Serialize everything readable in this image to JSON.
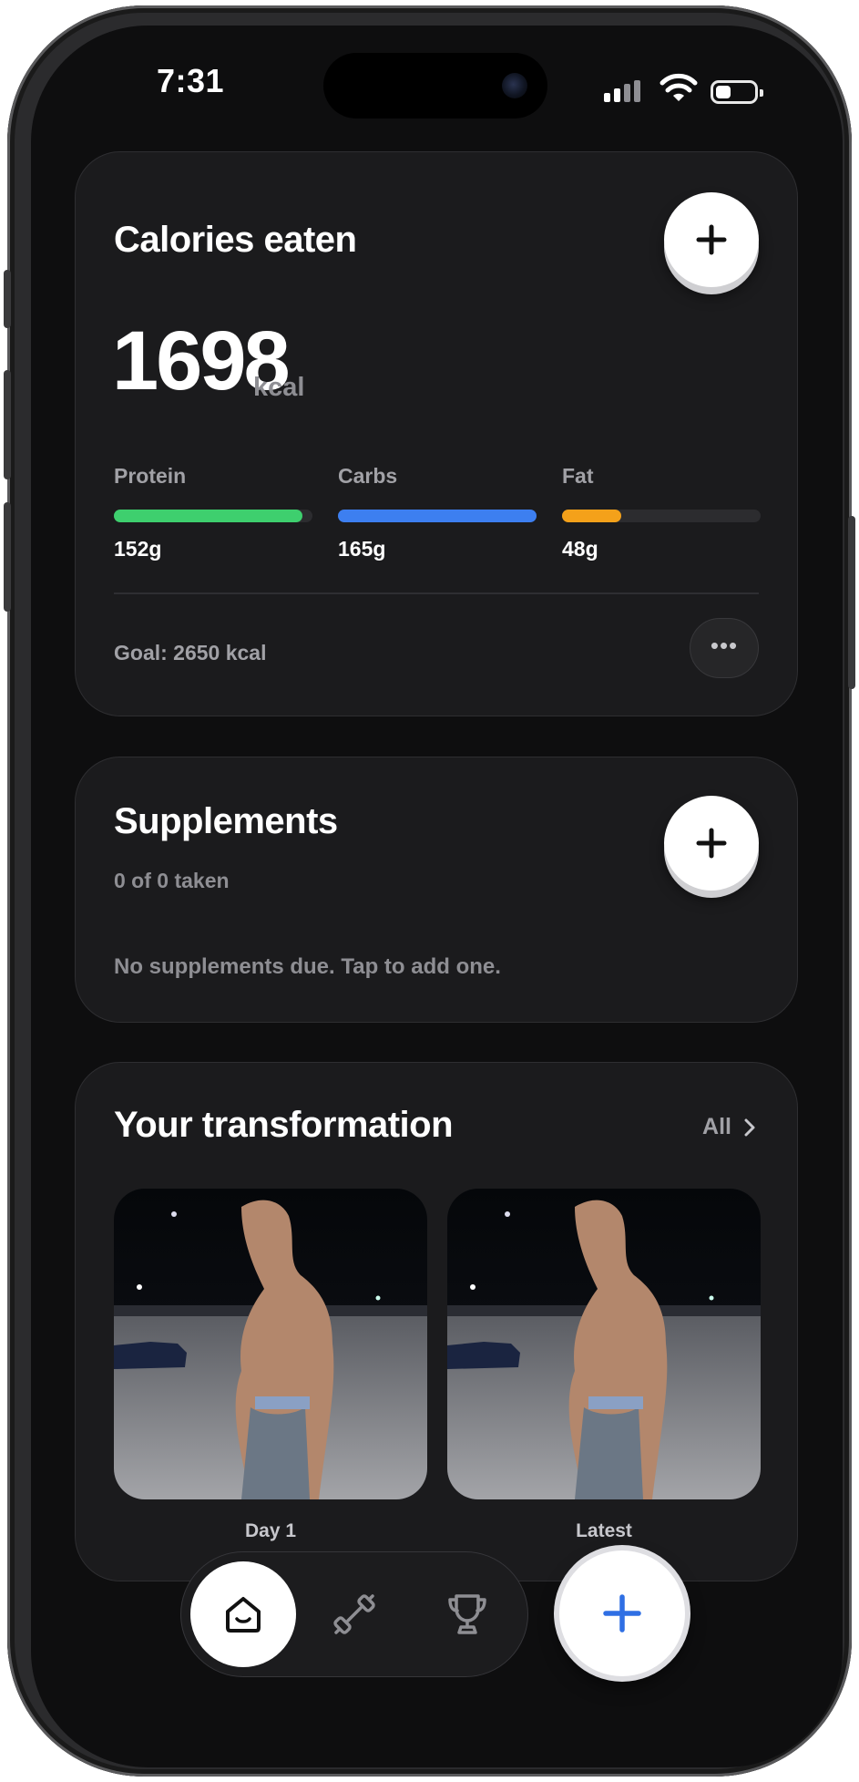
{
  "status_bar": {
    "time": "7:31"
  },
  "calories": {
    "title": "Calories eaten",
    "value": "1698",
    "unit": "kcal",
    "macros": [
      {
        "label": "Protein",
        "value": "152g",
        "fraction": 0.95,
        "color": "#3ecf6e"
      },
      {
        "label": "Carbs",
        "value": "165g",
        "fraction": 1.0,
        "color": "#3d7ff0"
      },
      {
        "label": "Fat",
        "value": "48g",
        "fraction": 0.3,
        "color": "#f4a11a"
      }
    ],
    "goal": "Goal: 2650 kcal",
    "more_label": "•••"
  },
  "supplements": {
    "title": "Supplements",
    "subtitle": "0 of 0 taken",
    "empty_text": "No supplements due. Tap to add one."
  },
  "transformation": {
    "title": "Your transformation",
    "all_label": "All",
    "photos": [
      {
        "caption": "Day 1"
      },
      {
        "caption": "Latest"
      }
    ]
  },
  "nav": {
    "items": [
      "home-icon",
      "dumbbell-icon",
      "trophy-icon"
    ],
    "fab_icon": "plus-icon",
    "accent": "#2f6fe4"
  }
}
